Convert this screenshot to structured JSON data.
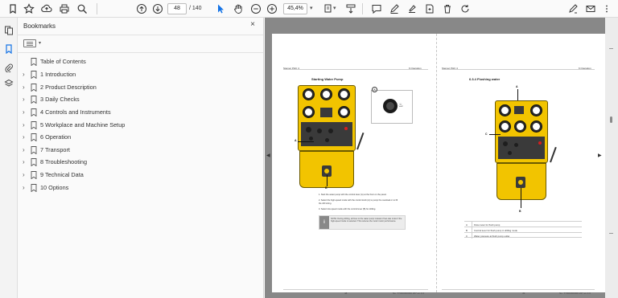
{
  "toolbar": {
    "page_current": "48",
    "page_total": "/ 140",
    "zoom": "45,4%",
    "icons": [
      "bookmark-icon",
      "star-icon",
      "upload-icon",
      "print-icon",
      "zoom-search-icon",
      "page-up-icon",
      "page-down-icon",
      "select-cursor-icon",
      "hand-icon",
      "zoom-out-icon",
      "zoom-in-icon",
      "page-fit-icon",
      "scroll-mode-icon",
      "comment-icon",
      "pen-icon",
      "highlight-icon",
      "stamp-icon",
      "delete-icon",
      "edit-pdf-icon",
      "share-mail-icon"
    ]
  },
  "bookmarks_panel": {
    "title": "Bookmarks",
    "close_glyph": "×",
    "items": [
      {
        "label": "Table of Contents",
        "expandable": false
      },
      {
        "label": "1 Introduction",
        "expandable": true
      },
      {
        "label": "2 Product Description",
        "expandable": true
      },
      {
        "label": "3 Daily Checks",
        "expandable": true
      },
      {
        "label": "4 Controls and Instruments",
        "expandable": true
      },
      {
        "label": "5 Workplace and Machine Setup",
        "expandable": true
      },
      {
        "label": "6 Operation",
        "expandable": true
      },
      {
        "label": "7 Transport",
        "expandable": true
      },
      {
        "label": "8 Troubleshooting",
        "expandable": true
      },
      {
        "label": "9 Technical Data",
        "expandable": true
      },
      {
        "label": "10 Options",
        "expandable": true
      }
    ]
  },
  "left_page": {
    "header_left": "Stemec PHC 4",
    "header_right": "6 Operation",
    "section_title": "Starting Water Pump",
    "inset_label": "A",
    "callout_a": "A",
    "callout_b": "B",
    "steps": [
      "1.   Start the water pump with the control lever (A) at the front on the panel.",
      "2.   Select the high-speed mode with the control knob (A) to pump the overload or to fill",
      "      the drill string.",
      "3.   Select low speed mode with the control lever (B) for drilling."
    ],
    "note_icon": "i",
    "note_text": "NOTE: During drilling, all lines to the water pump instead of low-rate motor if the high-speed mode is selected. This reduces the motor motor performance.",
    "footer_page": "48",
    "footer_doc": "No. T7000000000 267 en 4.0"
  },
  "right_page": {
    "header_left": "Stemec PHC 4",
    "header_right": "6 Operation",
    "section_title": "6.3.4 Flushing water",
    "callout_a": "A",
    "callout_b": "B",
    "callout_c": "C",
    "legend": [
      {
        "key": "A",
        "value": "Flow meter for flush pump"
      },
      {
        "key": "B",
        "value": "Control lever for flush pump in drilling mode"
      },
      {
        "key": "C",
        "value": "Water pressure at flush pump outlet"
      }
    ],
    "footer_page": "49",
    "footer_doc": "No. T7000000000 267 en 4.0"
  },
  "colors": {
    "panel_yellow": "#f2c400",
    "accent_blue": "#1473e6",
    "doc_gray": "#888888"
  }
}
